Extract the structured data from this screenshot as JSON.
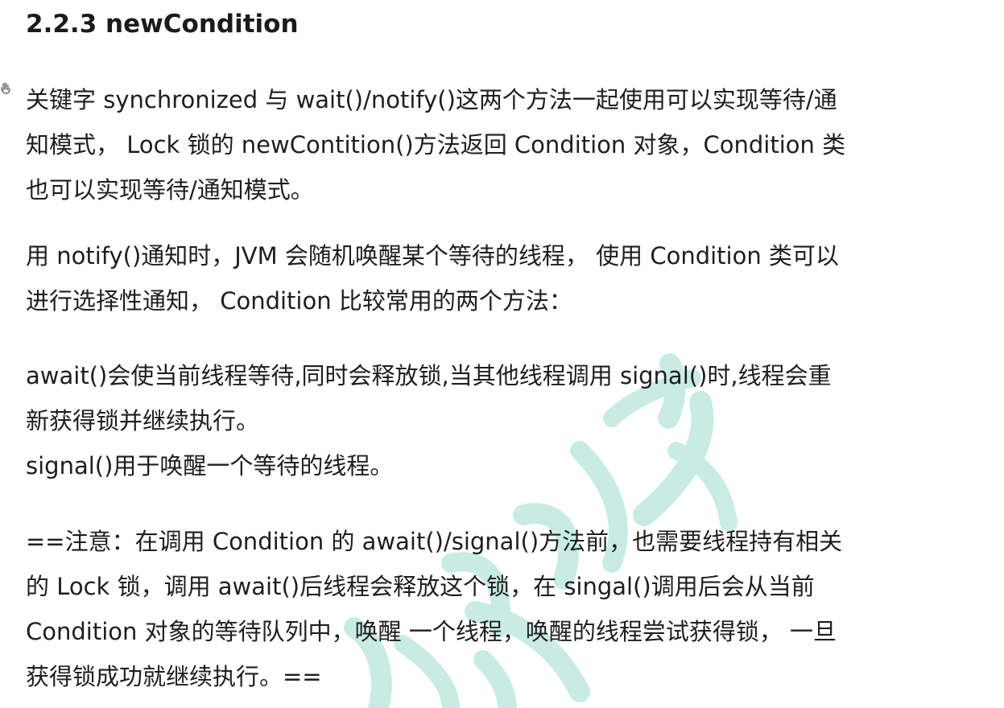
{
  "section": {
    "heading": "2.2.3 newCondition"
  },
  "paragraphs": [
    {
      "lines": [
        "关键字 synchronized 与 wait()/notify()这两个方法一起使用可以实现等待/通",
        "知模式， Lock 锁的 newContition()方法返回 Condition 对象，Condition 类",
        "也可以实现等待/通知模式。"
      ]
    },
    {
      "lines": [
        "用 notify()通知时，JVM 会随机唤醒某个等待的线程， 使用 Condition 类可以",
        "进行选择性通知， Condition 比较常用的两个方法："
      ]
    },
    {
      "lines": [
        "await()会使当前线程等待,同时会释放锁,当其他线程调用 signal()时,线程会重",
        "新获得锁并继续执行。",
        "signal()用于唤醒一个等待的线程。"
      ]
    },
    {
      "lines": [
        "==注意：在调用 Condition 的 await()/signal()方法前，也需要线程持有相关",
        "的 Lock 锁，调用 await()后线程会释放这个锁，在 singal()调用后会从当前",
        "Condition 对象的等待队列中，唤醒 一个线程，唤醒的线程尝试获得锁， 一旦",
        "获得锁成功就继续执行。=="
      ]
    }
  ],
  "colors": {
    "text": "#1e1e1e",
    "watermark": "#bfe9df"
  },
  "icons": {
    "margin_marker": "hand-pointer-icon"
  }
}
